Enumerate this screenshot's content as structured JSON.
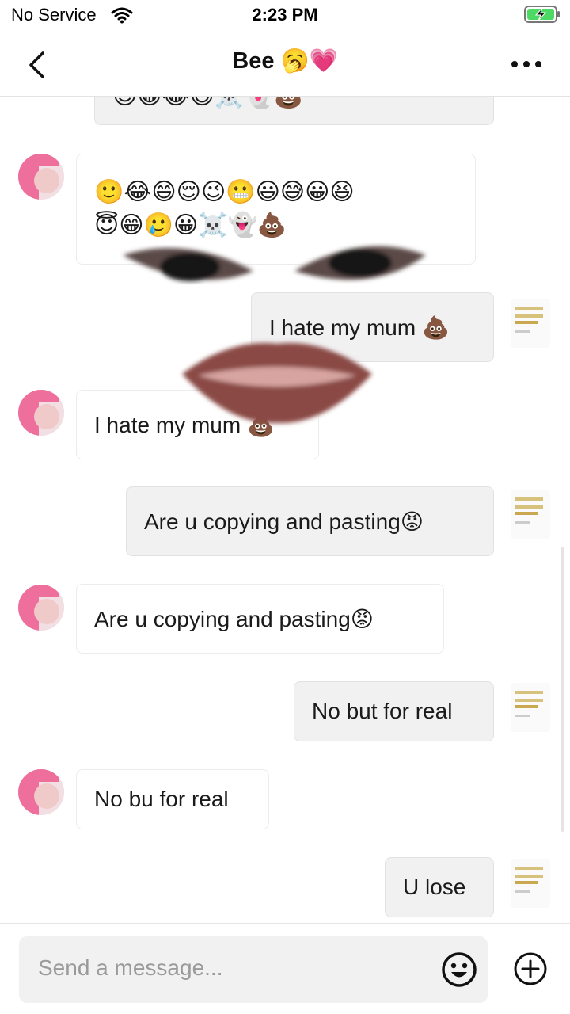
{
  "status_bar": {
    "carrier": "No Service",
    "time": "2:23 PM"
  },
  "header": {
    "title": "Bee 🥱💗"
  },
  "messages": [
    {
      "direction": "incoming",
      "emoji_row_1": "🙂😂😄😌😉😬😃😅😀😆",
      "emoji_row_2": "😇😁🥲😀☠️👻💩"
    },
    {
      "direction": "outgoing",
      "text": "I hate my mum 💩"
    },
    {
      "direction": "incoming",
      "text": "I hate my mum 💩"
    },
    {
      "direction": "outgoing",
      "text": "Are u copying and pasting😡"
    },
    {
      "direction": "incoming",
      "text": "Are u copying and pasting😡"
    },
    {
      "direction": "outgoing",
      "text": "No but for real"
    },
    {
      "direction": "incoming",
      "text": "No bu for real"
    },
    {
      "direction": "outgoing",
      "text": "U lose"
    }
  ],
  "top_partial_emoji": "😊😀😂😄☠️👻💩",
  "composer": {
    "placeholder": "Send a message..."
  },
  "icons": {
    "back": "chevron-left-icon",
    "more": "more-dots-icon",
    "emoji": "smiley-icon",
    "add": "plus-circle-icon",
    "wifi": "wifi-icon",
    "battery": "battery-charging-icon"
  },
  "colors": {
    "battery_fill": "#4cd964",
    "avatar_pink": "#ee6f9c",
    "bubble_sent": "#f1f1f2"
  }
}
